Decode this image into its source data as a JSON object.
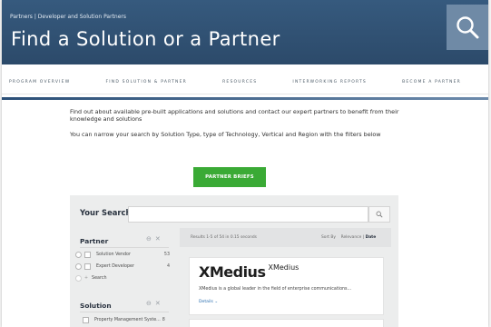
{
  "header": {
    "breadcrumb": "Partners | Developer and Solution Partners",
    "title": "Find a Solution or a Partner",
    "colors": {
      "banner": "#2f5073",
      "search_box": "#6f8aa6"
    },
    "search_icon": "magnifier-icon"
  },
  "nav": {
    "items": [
      "PROGRAM OVERVIEW",
      "FIND SOLUTION & PARTNER",
      "RESOURCES",
      "INTERWORKING REPORTS",
      "BECOME A PARTNER"
    ]
  },
  "intro": {
    "p1": "Find out about available pre-built applications and solutions and contact our expert partners to benefit from their knowledge and solutions",
    "p2": "You can narrow your search by Solution Type, type of Technology, Vertical and Region with the filters below"
  },
  "partner_briefs": {
    "label": "PARTNER BRIEFS",
    "color": "#3aaa35"
  },
  "search": {
    "label": "Your Search",
    "value": "",
    "placeholder": ""
  },
  "filters": {
    "partner": {
      "title": "Partner",
      "items": [
        {
          "label": "Solution Vendor",
          "count": "53"
        },
        {
          "label": "Expert Developer",
          "count": "4"
        }
      ],
      "search_label": "Search"
    },
    "solution": {
      "title": "Solution",
      "items": [
        {
          "label": "Property Management Syste...",
          "count": "8"
        }
      ]
    }
  },
  "results": {
    "summary": "Results 1-5 of 54 in 0.15 seconds",
    "sort_label": "Sort By",
    "sort_relevance": "Relevance",
    "sort_date": "Date",
    "cards": [
      {
        "logo_text": "XMedius",
        "name": "XMedius",
        "description": "XMedius is a global leader in the field of enterprise communications...",
        "details": "Details"
      }
    ]
  }
}
